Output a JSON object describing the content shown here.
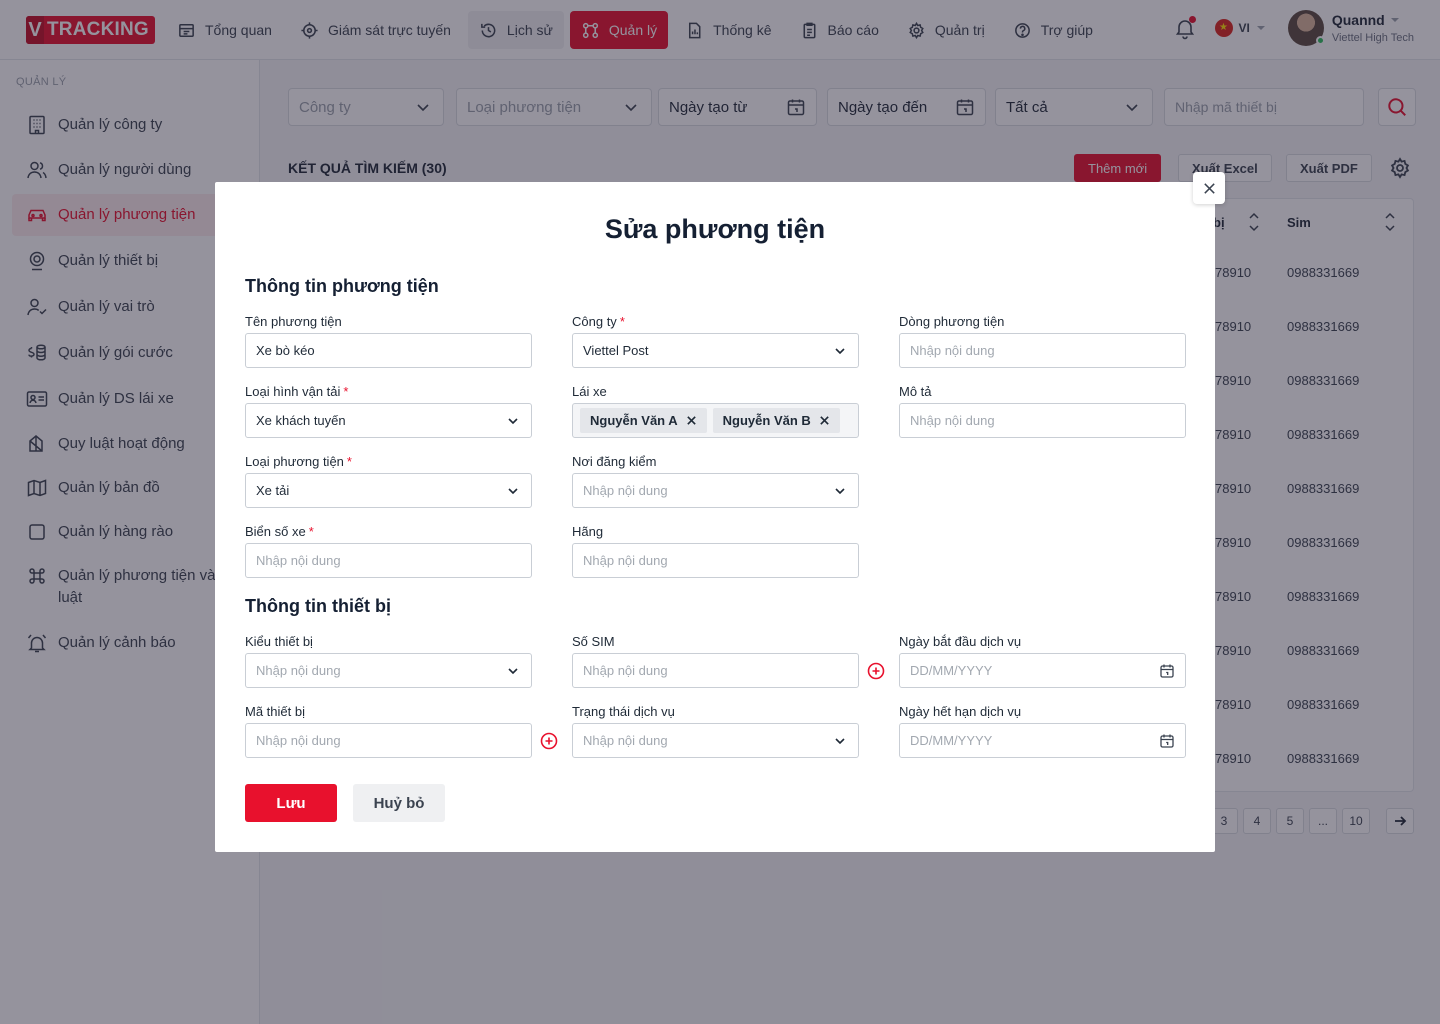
{
  "app": {
    "logo_v": "V",
    "logo_text": "TRACKING"
  },
  "nav": [
    {
      "label": "Tổng quan"
    },
    {
      "label": "Giám sát trực tuyến"
    },
    {
      "label": "Lịch sử"
    },
    {
      "label": "Quản lý"
    },
    {
      "label": "Thống kê"
    },
    {
      "label": "Báo cáo"
    },
    {
      "label": "Quản trị"
    },
    {
      "label": "Trợ giúp"
    }
  ],
  "user": {
    "lang": "VI",
    "name": "Quannd",
    "org": "Viettel High Tech"
  },
  "sidebar": {
    "title": "QUẢN LÝ",
    "items": [
      {
        "label": "Quản lý công ty"
      },
      {
        "label": "Quản lý người dùng"
      },
      {
        "label": "Quản lý phương tiện"
      },
      {
        "label": "Quản lý thiết bị"
      },
      {
        "label": "Quản lý vai trò"
      },
      {
        "label": "Quản lý gói cước"
      },
      {
        "label": "Quản lý DS lái xe"
      },
      {
        "label": "Quy luật hoạt động"
      },
      {
        "label": "Quản lý bản đồ"
      },
      {
        "label": "Quản lý hàng rào"
      },
      {
        "label": "Quản lý phương tiện và quy luật"
      },
      {
        "label": "Quản lý cảnh báo"
      }
    ]
  },
  "filters": {
    "company": "Công ty",
    "vehicle_type": "Loại phương tiện",
    "created_from": "Ngày tạo từ",
    "created_to": "Ngày tạo đến",
    "status": "Tất cả",
    "device_code_placeholder": "Nhập mã thiết bị"
  },
  "results": {
    "title": "KẾT QUẢ TÌM KIẾM (30)",
    "add_label": "Thêm mới",
    "excel_label": "Xuất Excel",
    "pdf_label": "Xuất PDF",
    "col_device_fragment": "bị",
    "col_sim": "Sim",
    "rows": [
      {
        "device": "78910",
        "sim": "0988331669"
      },
      {
        "device": "78910",
        "sim": "0988331669"
      },
      {
        "device": "78910",
        "sim": "0988331669"
      },
      {
        "device": "78910",
        "sim": "0988331669"
      },
      {
        "device": "78910",
        "sim": "0988331669"
      },
      {
        "device": "78910",
        "sim": "0988331669"
      },
      {
        "device": "78910",
        "sim": "0988331669"
      },
      {
        "device": "78910",
        "sim": "0988331669"
      },
      {
        "device": "78910",
        "sim": "0988331669"
      },
      {
        "device": "78910",
        "sim": "0988331669"
      }
    ],
    "pages": [
      "3",
      "4",
      "5",
      "...",
      "10"
    ]
  },
  "modal": {
    "title": "Sửa phương tiện",
    "section_vehicle": "Thông tin phương tiện",
    "section_device": "Thông tin thiết bị",
    "required_mark": "*",
    "vehicle_name": {
      "label": "Tên phương tiện",
      "value": "Xe bò kéo"
    },
    "company": {
      "label": "Công ty",
      "value": "Viettel Post"
    },
    "vehicle_line": {
      "label": "Dòng phương tiện",
      "placeholder": "Nhập nội dung"
    },
    "transport_type": {
      "label": "Loại hình vận tải",
      "value": "Xe khách tuyến"
    },
    "drivers": {
      "label": "Lái xe",
      "tags": [
        "Nguyễn Văn A",
        "Nguyễn Văn B"
      ]
    },
    "description": {
      "label": "Mô tả",
      "placeholder": "Nhập nội dung"
    },
    "vehicle_kind": {
      "label": "Loại phương tiện",
      "value": "Xe tải"
    },
    "inspection_place": {
      "label": "Nơi đăng kiểm",
      "placeholder": "Nhập nội dung"
    },
    "plate": {
      "label": "Biển số xe",
      "placeholder": "Nhập nội dung"
    },
    "brand": {
      "label": "Hãng",
      "placeholder": "Nhập nội dung"
    },
    "device_model": {
      "label": "Kiểu thiết bị",
      "placeholder": "Nhập nội dung"
    },
    "sim_number": {
      "label": "Số SIM",
      "placeholder": "Nhập nội dung"
    },
    "service_start": {
      "label": "Ngày bắt đầu dịch vụ",
      "placeholder": "DD/MM/YYYY"
    },
    "device_code": {
      "label": "Mã thiết bị",
      "placeholder": "Nhập nội dung"
    },
    "service_status": {
      "label": "Trạng thái dịch vụ",
      "placeholder": "Nhập nội dung"
    },
    "service_end": {
      "label": "Ngày hết hạn dịch vụ",
      "placeholder": "DD/MM/YYYY"
    },
    "save_label": "Lưu",
    "cancel_label": "Huỷ bỏ"
  },
  "colors": {
    "brand": "#e8112d",
    "overlay": "rgba(33,30,50,0.48)"
  }
}
